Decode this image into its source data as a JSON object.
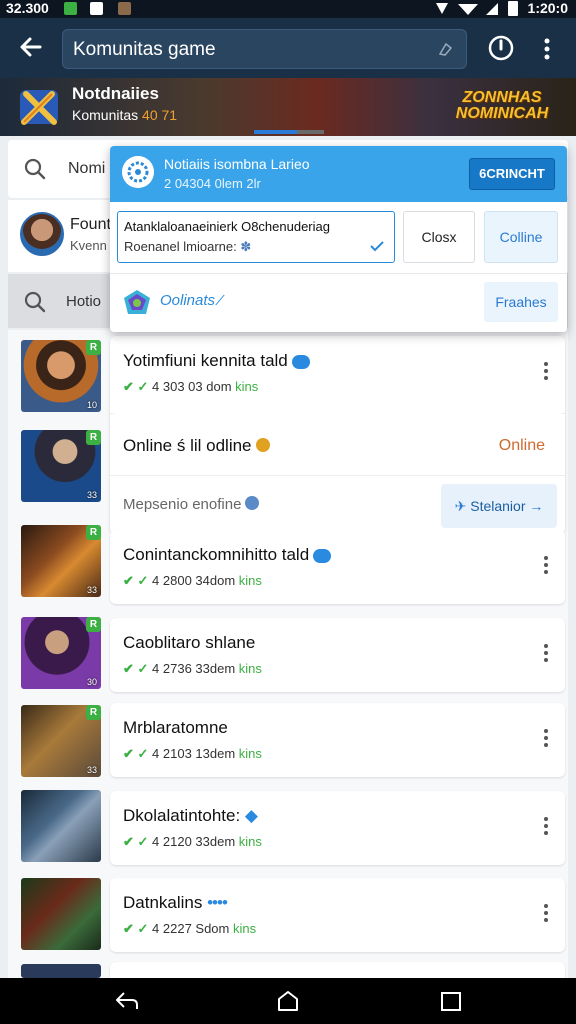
{
  "status_bar": {
    "time_left": "32.300",
    "time_right": "1:20:0"
  },
  "app_bar": {
    "search_value": "Komunitas game"
  },
  "banner": {
    "title": "Notdnaiies",
    "subtitle": "Komunitas",
    "subtitle_count": "40 71",
    "game_logo": "ZONNHAS NOMINICAH",
    "carousel_progress": 0.62
  },
  "underlay": {
    "search_text": "Nomi",
    "profile_line1": "Fount",
    "profile_line2": "Kvenn",
    "search2_text": "Hotio"
  },
  "popup": {
    "header_title": "Notiaiis isombna Larieo",
    "header_subtitle": "2 04304 0lem 2lr",
    "header_button": "6CRINCHT",
    "field_line1": "Atanklaloanaeinierk O8chenuderiag",
    "field_line2": "Roenanel lmioarne:",
    "close_button": "Closx",
    "online_button": "Colline",
    "row_text": "Oolinats",
    "row_button": "Fraahes"
  },
  "expanded_card": {
    "name": "Yotimfiuni kennita tald",
    "meta_code": "4 303 03 ",
    "meta_suffix": "dom",
    "meta_kins": "kins",
    "row2_text": "Online ś lil odline",
    "row2_status": "Online",
    "row3_text": "Mepsenio enofine",
    "row3_button": "Stelanior"
  },
  "games": [
    {
      "name": "Conintanckomnihitto tald",
      "code": "4 2800 34",
      "suffix": "dom",
      "kins": "kins",
      "lvl": "33"
    },
    {
      "name": "Caoblitaro shlane",
      "code": "4 2736 33",
      "suffix": "dem",
      "kins": "kins",
      "lvl": "30"
    },
    {
      "name": "Mrblaratomne",
      "code": "4 2103 13",
      "suffix": "dem",
      "kins": "kins",
      "lvl": "33"
    },
    {
      "name": "Dkolalatintohte:",
      "code": "4 2120 33",
      "suffix": "dem",
      "kins": "kins",
      "lvl": ""
    },
    {
      "name": "Datnkalins",
      "code": "4 2227 S",
      "suffix": "dom",
      "kins": "kins",
      "lvl": ""
    }
  ],
  "first_thumb_level": "10",
  "second_thumb_level": "33",
  "colors": {
    "appbar": "#1a3046",
    "accent_blue": "#3aa4ea",
    "green": "#3cb043",
    "online_orange": "#d06a30"
  },
  "icons": [
    "back-arrow-icon",
    "clear-icon",
    "timer-icon",
    "more-vert-icon",
    "search-icon",
    "check-icon",
    "kebab-icon",
    "nav-back-icon",
    "nav-home-icon",
    "nav-recents-icon"
  ]
}
